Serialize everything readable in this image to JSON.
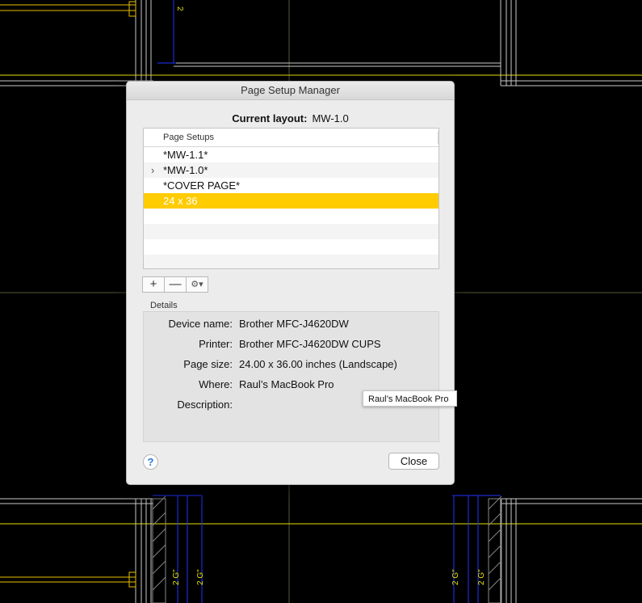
{
  "dialog": {
    "title": "Page Setup Manager",
    "current_layout_label": "Current layout:",
    "current_layout_value": "MW-1.0",
    "table_header": "Page Setups",
    "setups": [
      "*MW-1.1*",
      "*MW-1.0*",
      "*COVER PAGE*",
      "24 x 36"
    ],
    "selected_index": 3,
    "expanded_index": 1,
    "toolbar": {
      "add": "+",
      "remove": "—",
      "gear": "⚙▾"
    },
    "details_title": "Details",
    "details": [
      {
        "label": "Device name:",
        "value": "Brother MFC-J4620DW"
      },
      {
        "label": "Printer:",
        "value": "Brother MFC-J4620DW CUPS"
      },
      {
        "label": "Page size:",
        "value": "24.00 x 36.00 inches (Landscape)"
      },
      {
        "label": "Where:",
        "value": "Raul’s MacBook Pro"
      },
      {
        "label": "Description:",
        "value": ""
      }
    ],
    "tooltip": "Raul’s MacBook Pro",
    "help_label": "?",
    "close_label": "Close"
  },
  "background": {
    "dimension_labels": [
      "2",
      "2 G\"",
      "2 G\"",
      "2 G\"",
      "2 G\""
    ],
    "colors": {
      "line_gray": "#c8c8c8",
      "line_yellow": "#e8e000",
      "line_blue": "#2233ff",
      "accent_selection": "#ffcc00"
    }
  }
}
